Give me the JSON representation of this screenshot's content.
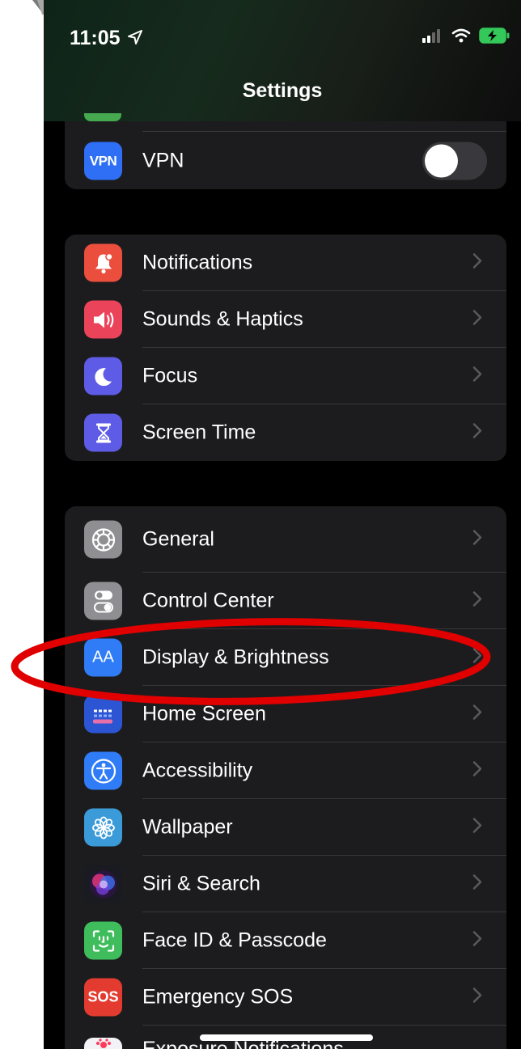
{
  "status_bar": {
    "time": "11:05",
    "icons": [
      "location-arrow-icon",
      "cellular-signal-icon",
      "wifi-icon",
      "battery-charging-icon"
    ]
  },
  "nav": {
    "title": "Settings"
  },
  "groups": [
    {
      "rows": [
        {
          "label": "VPN",
          "icon": "vpn-icon",
          "icon_text": "VPN",
          "icon_bg": "#2e6ff5",
          "control": "toggle",
          "toggle_on": false
        }
      ]
    },
    {
      "rows": [
        {
          "label": "Notifications",
          "icon": "notifications-icon",
          "icon_bg": "#eb4e3d"
        },
        {
          "label": "Sounds & Haptics",
          "icon": "speaker-icon",
          "icon_bg": "#eb445a"
        },
        {
          "label": "Focus",
          "icon": "moon-icon",
          "icon_bg": "#5e5ce6"
        },
        {
          "label": "Screen Time",
          "icon": "hourglass-icon",
          "icon_bg": "#5e5ce6"
        }
      ]
    },
    {
      "rows": [
        {
          "label": "General",
          "icon": "gear-icon",
          "icon_bg": "#8e8e93"
        },
        {
          "label": "Control Center",
          "icon": "toggles-icon",
          "icon_bg": "#8e8e93"
        },
        {
          "label": "Display & Brightness",
          "icon": "display-icon",
          "icon_text": "AA",
          "icon_bg": "#2f7cf6",
          "highlighted": true
        },
        {
          "label": "Home Screen",
          "icon": "home-screen-icon",
          "icon_bg": "#2c55d3"
        },
        {
          "label": "Accessibility",
          "icon": "accessibility-icon",
          "icon_bg": "#2f7cf6"
        },
        {
          "label": "Wallpaper",
          "icon": "wallpaper-flower-icon",
          "icon_bg": "#3a9bd8"
        },
        {
          "label": "Siri & Search",
          "icon": "siri-icon",
          "icon_bg": "#2a1f3a"
        },
        {
          "label": "Face ID & Passcode",
          "icon": "face-id-icon",
          "icon_bg": "#3fbd5c"
        },
        {
          "label": "Emergency SOS",
          "icon": "sos-icon",
          "icon_text": "SOS",
          "icon_bg": "#e33b30"
        }
      ]
    }
  ],
  "partial_bottom_label": "Exposure Notifications",
  "colors": {
    "highlight_ring": "#e00000",
    "cell_bg": "#1c1c1e",
    "chevron": "#5a5a5e"
  }
}
